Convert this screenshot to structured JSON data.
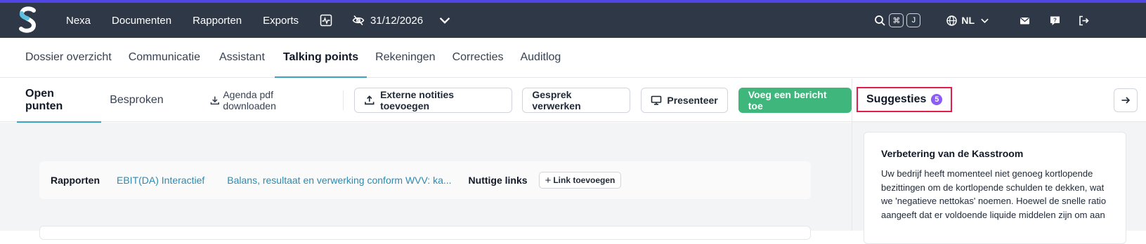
{
  "topbar": {
    "nav": [
      "Nexa",
      "Documenten",
      "Rapporten",
      "Exports"
    ],
    "date": "31/12/2026",
    "kbd": [
      "⌘",
      "J"
    ],
    "language": "NL",
    "accent": "#4f46e5",
    "background": "#2f3846"
  },
  "tabs": [
    "Dossier overzicht",
    "Communicatie",
    "Assistant",
    "Talking points",
    "Rekeningen",
    "Correcties",
    "Auditlog"
  ],
  "subtabs": {
    "open": "Open punten",
    "discussed": "Besproken"
  },
  "actions": {
    "download": "Agenda pdf downloaden",
    "external": "Externe notities toevoegen",
    "process": "Gesprek verwerken",
    "present": "Presenteer",
    "add_message": "Voeg een bericht toe"
  },
  "links": {
    "reports_label": "Rapporten",
    "report1": "EBIT(DA) Interactief",
    "report2": "Balans, resultaat en verwerking conform WVV: ka...",
    "useful_label": "Nuttige links",
    "add_link": "Link toevoegen"
  },
  "suggestions": {
    "title": "Suggesties",
    "count": "5",
    "card_title": "Verbetering van de Kasstroom",
    "card_text": "Uw bedrijf heeft momenteel niet genoeg kortlopende bezittingen om de kortlopende schulden te dekken, wat we 'negatieve nettokas' noemen. Hoewel de snelle ratio aangeeft dat er voldoende liquide middelen zijn om aan"
  }
}
